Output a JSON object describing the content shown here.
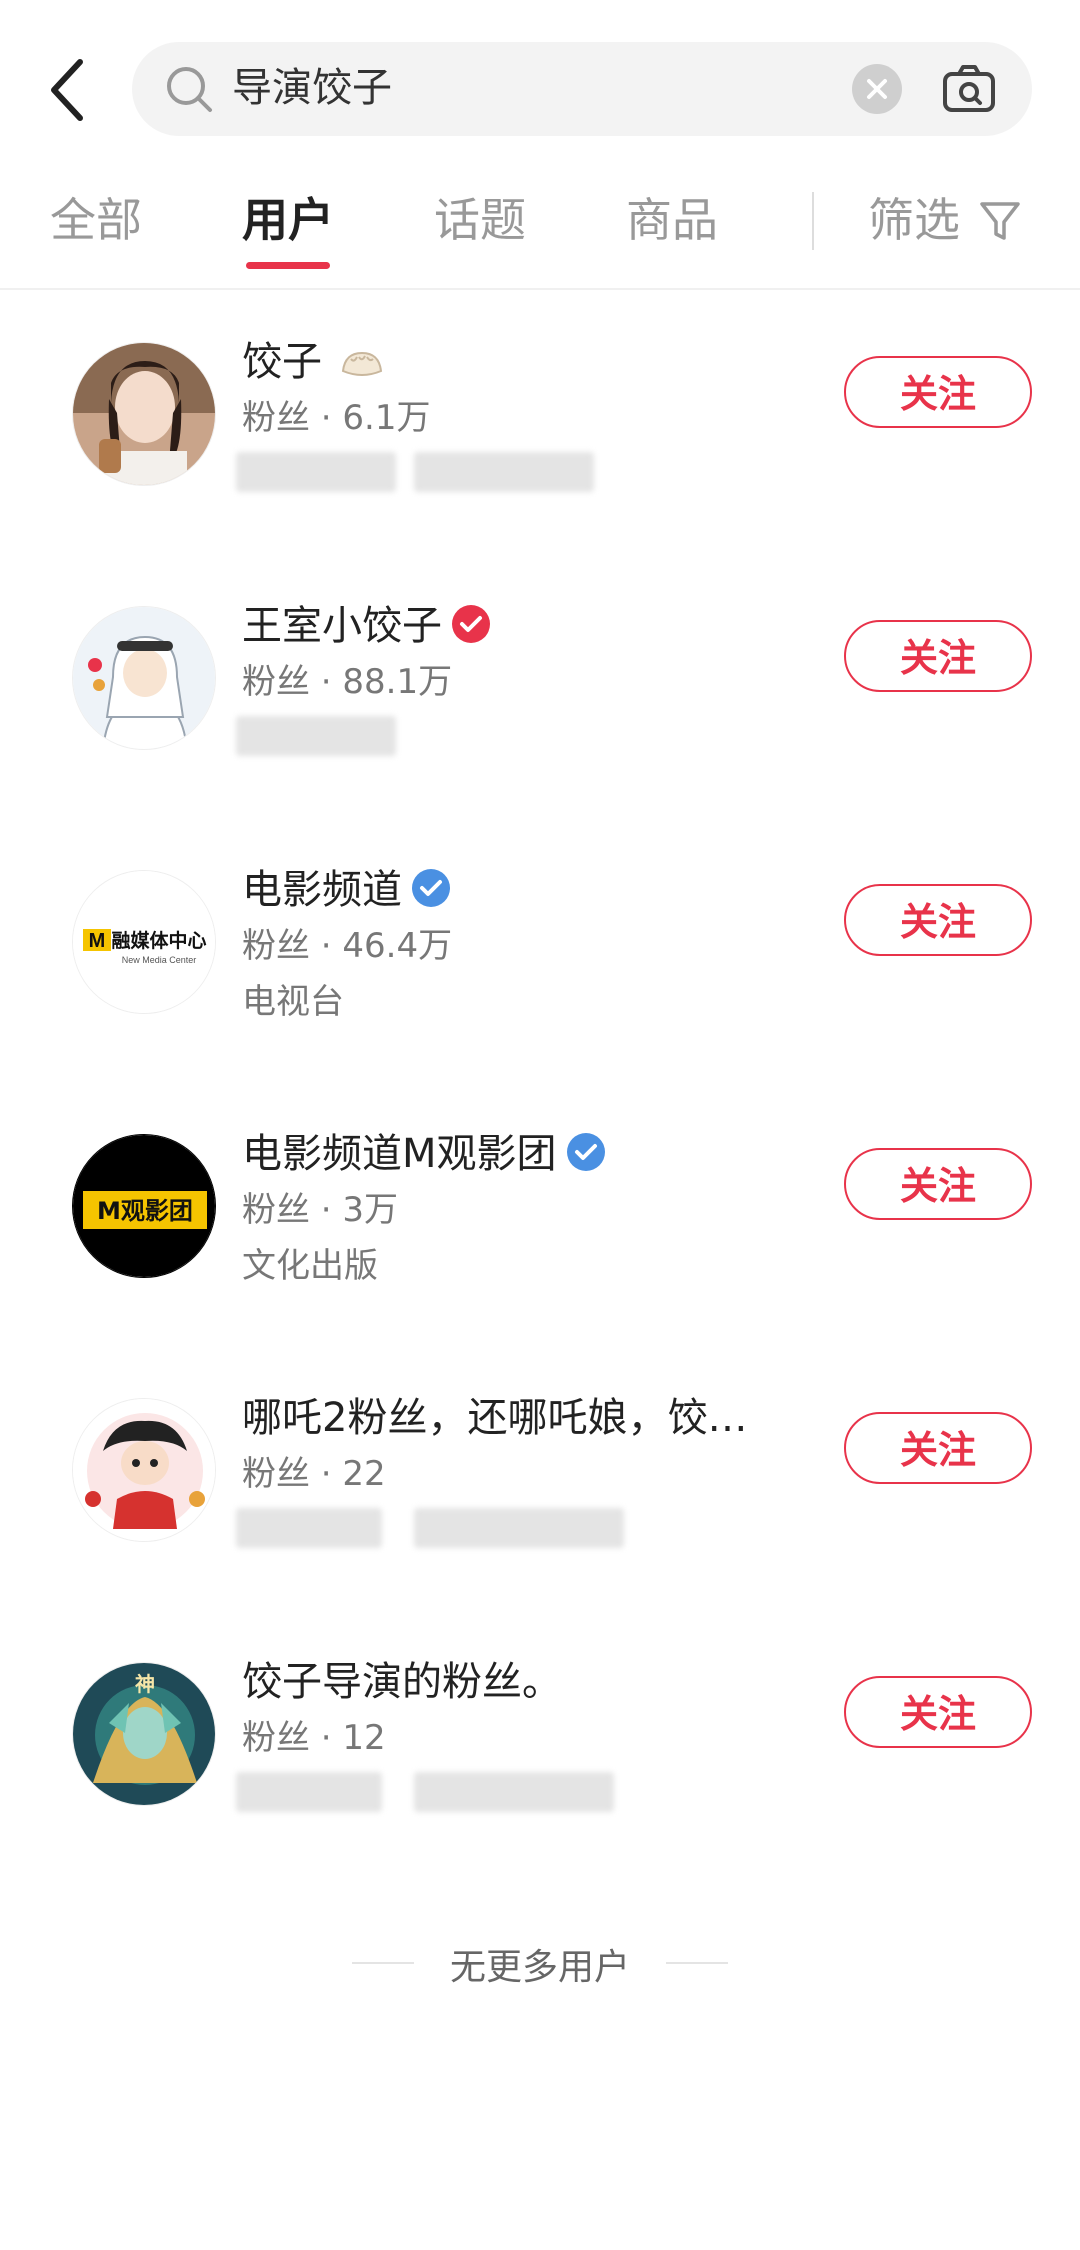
{
  "search": {
    "query": "导演饺子"
  },
  "tabs": [
    {
      "label": "全部"
    },
    {
      "label": "用户"
    },
    {
      "label": "话题"
    },
    {
      "label": "商品"
    }
  ],
  "filter": {
    "label": "筛选"
  },
  "users": [
    {
      "name": "饺子",
      "fans": "粉丝 · 6.1万",
      "sub": "",
      "badge": "none",
      "follow": "关注"
    },
    {
      "name": "王室小饺子",
      "fans": "粉丝 · 88.1万",
      "sub": "",
      "badge": "red",
      "follow": "关注"
    },
    {
      "name": "电影频道",
      "fans": "粉丝 · 46.4万",
      "sub": "电视台",
      "badge": "blue",
      "follow": "关注"
    },
    {
      "name": "电影频道M观影团",
      "fans": "粉丝 · 3万",
      "sub": "文化出版",
      "badge": "blue",
      "follow": "关注"
    },
    {
      "name": "哪吒2粉丝，还哪吒娘，饺…",
      "fans": "粉丝 · 22",
      "sub": "",
      "badge": "none",
      "follow": "关注"
    },
    {
      "name": "饺子导演的粉丝。",
      "fans": "粉丝 · 12",
      "sub": "",
      "badge": "none",
      "follow": "关注"
    }
  ],
  "avatars": {
    "a3_text_main": "融媒体中心",
    "a3_text_sub": "New Media Center",
    "a4_text": "M观影团",
    "a6_text": "神"
  },
  "footer": {
    "text": "无更多用户"
  },
  "colors": {
    "accent": "#e8334a",
    "verified_blue": "#4a90e2",
    "verified_red": "#e8334a"
  }
}
